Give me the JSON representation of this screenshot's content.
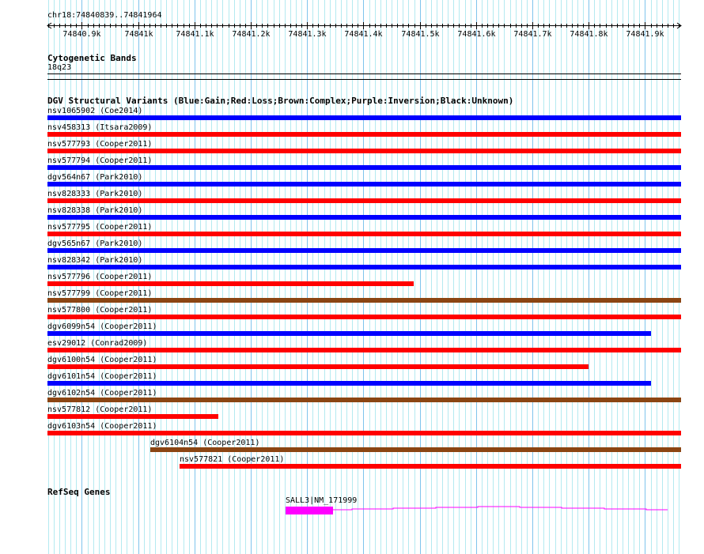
{
  "ruler": {
    "region": "chr18:74840839..74841964",
    "start": 74840839,
    "end": 74841964,
    "ticks": [
      "74840.9k",
      "74841k",
      "74841.1k",
      "74841.2k",
      "74841.3k",
      "74841.4k",
      "74841.5k",
      "74841.6k",
      "74841.7k",
      "74841.8k",
      "74841.9k"
    ]
  },
  "cytoband": {
    "title": "Cytogenetic Bands",
    "band": "18q23"
  },
  "dgv": {
    "title": "DGV Structural Variants (Blue:Gain;Red:Loss;Brown:Complex;Purple:Inversion;Black:Unknown)",
    "colors": {
      "gain": "#0000ff",
      "loss": "#ff0000",
      "complex": "#8b4513"
    },
    "variants": [
      {
        "label": "nsv1065902 (Coe2014)",
        "type": "gain",
        "start": 74840839,
        "end": 74841964
      },
      {
        "label": "nsv458313 (Itsara2009)",
        "type": "loss",
        "start": 74840839,
        "end": 74841964
      },
      {
        "label": "nsv577793 (Cooper2011)",
        "type": "loss",
        "start": 74840839,
        "end": 74841964
      },
      {
        "label": "nsv577794 (Cooper2011)",
        "type": "gain",
        "start": 74840839,
        "end": 74841964
      },
      {
        "label": "dgv564n67 (Park2010)",
        "type": "gain",
        "start": 74840839,
        "end": 74841964
      },
      {
        "label": "nsv828333 (Park2010)",
        "type": "loss",
        "start": 74840839,
        "end": 74841964
      },
      {
        "label": "nsv828338 (Park2010)",
        "type": "gain",
        "start": 74840839,
        "end": 74841964
      },
      {
        "label": "nsv577795 (Cooper2011)",
        "type": "loss",
        "start": 74840839,
        "end": 74841964
      },
      {
        "label": "dgv565n67 (Park2010)",
        "type": "gain",
        "start": 74840839,
        "end": 74841964
      },
      {
        "label": "nsv828342 (Park2010)",
        "type": "gain",
        "start": 74840839,
        "end": 74841964
      },
      {
        "label": "nsv577796 (Cooper2011)",
        "type": "loss",
        "start": 74840839,
        "end": 74841489
      },
      {
        "label": "nsv577799 (Cooper2011)",
        "type": "complex",
        "start": 74840839,
        "end": 74841964
      },
      {
        "label": "nsv577800 (Cooper2011)",
        "type": "loss",
        "start": 74840839,
        "end": 74841964
      },
      {
        "label": "dgv6099n54 (Cooper2011)",
        "type": "gain",
        "start": 74840839,
        "end": 74841910
      },
      {
        "label": "esv29012 (Conrad2009)",
        "type": "loss",
        "start": 74840839,
        "end": 74841964
      },
      {
        "label": "dgv6100n54 (Cooper2011)",
        "type": "loss",
        "start": 74840839,
        "end": 74841799
      },
      {
        "label": "dgv6101n54 (Cooper2011)",
        "type": "gain",
        "start": 74840839,
        "end": 74841910
      },
      {
        "label": "dgv6102n54 (Cooper2011)",
        "type": "complex",
        "start": 74840839,
        "end": 74841964
      },
      {
        "label": "nsv577812 (Cooper2011)",
        "type": "loss",
        "start": 74840839,
        "end": 74841143
      },
      {
        "label": "dgv6103n54 (Cooper2011)",
        "type": "loss",
        "start": 74840839,
        "end": 74841964
      },
      {
        "label": "dgv6104n54 (Cooper2011)",
        "type": "complex",
        "start": 74841022,
        "end": 74841964
      },
      {
        "label": "nsv577821 (Cooper2011)",
        "type": "loss",
        "start": 74841073,
        "end": 74841964
      }
    ]
  },
  "refseq": {
    "title": "RefSeq Genes",
    "gene_label": "SALL3|NM_171999",
    "color": "#ff00ff"
  }
}
